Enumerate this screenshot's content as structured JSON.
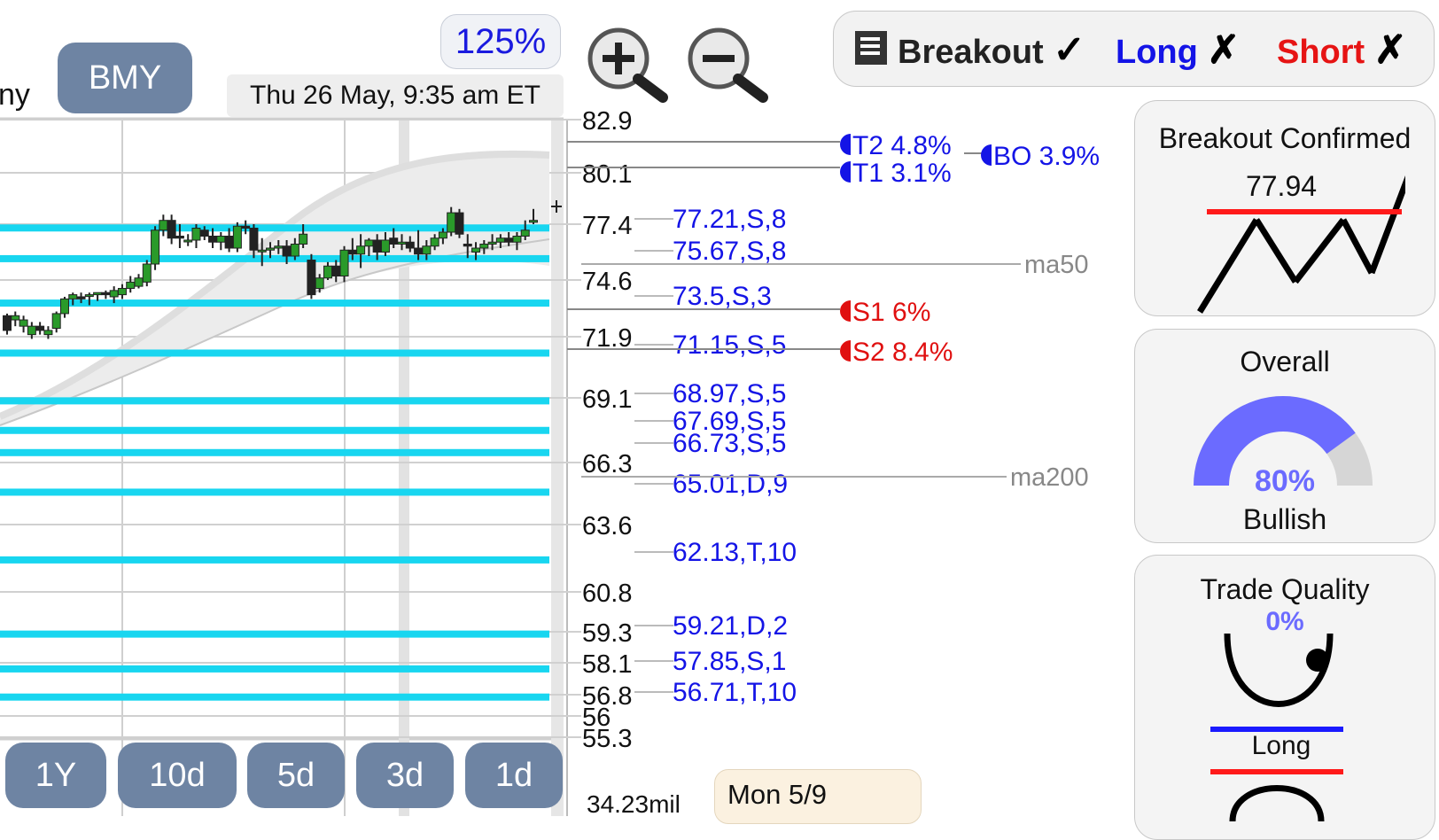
{
  "toolbar": {
    "partial_title": "ny",
    "ticker": "BMY",
    "zoom": "125%",
    "datetime": "Thu 26 May, 9:35 am ET",
    "zoom_in_icon": "magnifier-plus-icon",
    "zoom_out_icon": "magnifier-minus-icon"
  },
  "filters": {
    "menu_icon": "list-icon",
    "breakout": {
      "label": "Breakout",
      "mark": "✓",
      "color": "#222222"
    },
    "long": {
      "label": "Long",
      "mark": "✗",
      "color": "#1414e6"
    },
    "short": {
      "label": "Short",
      "mark": "✗",
      "color": "#e61414"
    }
  },
  "timeframes": [
    "1Y",
    "10d",
    "5d",
    "3d",
    "1d"
  ],
  "hover_date": "Mon 5/9",
  "chart_data": {
    "type": "candlestick",
    "y_axis": {
      "min": 55.3,
      "max": 82.9,
      "ticks": [
        "82.9",
        "80.1",
        "77.4",
        "74.6",
        "71.9",
        "69.1",
        "66.3",
        "63.6",
        "60.8",
        "59.3",
        "58.1",
        "56.8",
        "56",
        "55.3"
      ]
    },
    "volume_label": "34.23mil",
    "candles": [
      [
        72.9,
        73.0,
        72.0,
        72.2
      ],
      [
        72.7,
        73.1,
        72.4,
        72.9
      ],
      [
        72.4,
        72.9,
        72.1,
        72.7
      ],
      [
        72.0,
        72.6,
        71.8,
        72.4
      ],
      [
        72.4,
        72.6,
        72.0,
        72.2
      ],
      [
        72.0,
        72.4,
        71.8,
        72.2
      ],
      [
        72.3,
        73.1,
        72.1,
        73.0
      ],
      [
        73.0,
        73.8,
        72.8,
        73.7
      ],
      [
        73.7,
        74.0,
        73.4,
        73.9
      ],
      [
        73.8,
        74.0,
        73.5,
        73.7
      ],
      [
        73.9,
        74.0,
        73.4,
        73.9
      ],
      [
        73.9,
        74.0,
        73.6,
        74.0
      ],
      [
        74.0,
        74.1,
        73.7,
        73.9
      ],
      [
        73.8,
        74.3,
        73.5,
        74.1
      ],
      [
        73.9,
        74.4,
        73.7,
        74.2
      ],
      [
        74.2,
        74.8,
        74.0,
        74.5
      ],
      [
        74.3,
        74.9,
        74.2,
        74.7
      ],
      [
        74.5,
        75.6,
        74.3,
        75.4
      ],
      [
        75.4,
        77.3,
        75.1,
        77.1
      ],
      [
        77.1,
        77.9,
        76.8,
        77.6
      ],
      [
        77.6,
        77.9,
        76.4,
        76.7
      ],
      [
        76.8,
        77.4,
        76.2,
        76.7
      ],
      [
        76.6,
        76.9,
        76.3,
        76.6
      ],
      [
        76.6,
        77.4,
        76.2,
        77.2
      ],
      [
        77.1,
        77.3,
        76.6,
        76.8
      ],
      [
        76.8,
        77.2,
        76.2,
        76.5
      ],
      [
        76.5,
        77.0,
        76.1,
        76.8
      ],
      [
        76.8,
        77.2,
        76.0,
        76.2
      ],
      [
        76.2,
        77.5,
        76.0,
        77.3
      ],
      [
        77.3,
        77.6,
        76.9,
        77.2
      ],
      [
        77.2,
        77.4,
        75.7,
        76.1
      ],
      [
        76.1,
        76.7,
        75.3,
        76.1
      ],
      [
        76.1,
        76.5,
        75.7,
        76.2
      ],
      [
        76.2,
        76.6,
        75.9,
        76.3
      ],
      [
        76.3,
        76.6,
        75.4,
        75.8
      ],
      [
        75.8,
        76.7,
        75.6,
        76.4
      ],
      [
        76.4,
        77.4,
        76.2,
        76.9
      ],
      [
        75.6,
        75.9,
        73.7,
        73.9
      ],
      [
        74.2,
        74.9,
        74.0,
        74.7
      ],
      [
        74.7,
        75.5,
        74.6,
        75.3
      ],
      [
        75.3,
        75.6,
        74.5,
        74.8
      ],
      [
        74.8,
        76.3,
        74.5,
        76.1
      ],
      [
        76.1,
        76.7,
        75.6,
        75.9
      ],
      [
        75.9,
        76.9,
        75.2,
        76.3
      ],
      [
        76.3,
        76.7,
        75.8,
        76.6
      ],
      [
        76.6,
        76.9,
        75.6,
        76.0
      ],
      [
        76.0,
        77.0,
        75.8,
        76.6
      ],
      [
        76.7,
        77.2,
        76.2,
        76.4
      ],
      [
        76.4,
        76.9,
        76.1,
        76.5
      ],
      [
        76.5,
        76.8,
        76.0,
        76.2
      ],
      [
        76.2,
        77.1,
        75.6,
        75.9
      ],
      [
        75.9,
        76.6,
        75.6,
        76.3
      ],
      [
        76.3,
        76.9,
        76.1,
        76.7
      ],
      [
        76.7,
        77.2,
        76.4,
        77.0
      ],
      [
        77.0,
        78.3,
        76.8,
        78.0
      ],
      [
        78.0,
        78.2,
        76.7,
        76.9
      ],
      [
        76.4,
        76.9,
        75.7,
        76.3
      ],
      [
        76.0,
        76.5,
        75.6,
        76.2
      ],
      [
        76.2,
        76.6,
        75.9,
        76.4
      ],
      [
        76.4,
        76.9,
        76.1,
        76.5
      ],
      [
        76.5,
        76.9,
        76.2,
        76.7
      ],
      [
        76.7,
        77.0,
        76.3,
        76.5
      ],
      [
        76.5,
        77.0,
        76.1,
        76.8
      ],
      [
        76.8,
        77.6,
        76.6,
        77.1
      ],
      [
        77.5,
        78.2,
        77.4,
        77.6
      ]
    ],
    "support_levels": [
      77.21,
      75.67,
      73.5,
      71.15,
      68.97,
      67.69,
      66.73,
      65.01,
      62.13,
      59.21,
      57.85,
      56.71
    ],
    "level_labels": [
      "77.21,S,8",
      "75.67,S,8",
      "73.5,S,3",
      "71.15,S,5",
      "68.97,S,5",
      "67.69,S,5",
      "66.73,S,5",
      "65.01,D,9",
      "62.13,T,10",
      "59.21,D,2",
      "57.85,S,1",
      "56.71,T,10"
    ],
    "moving_averages": [
      {
        "name": "ma50",
        "value": 75.6
      },
      {
        "name": "ma200",
        "value": 65.3
      }
    ],
    "targets": [
      {
        "label": "T2 4.8%",
        "value": 81.7
      },
      {
        "label": "T1 3.1%",
        "value": 80.3
      }
    ],
    "breakout": {
      "label": "BO 3.9%",
      "value": 81.0
    },
    "stops": [
      {
        "label": "S1 6%",
        "value": 73.3
      },
      {
        "label": "S2 8.4%",
        "value": 71.4
      }
    ],
    "colors": {
      "up": "#2a9a2a",
      "down": "#222222",
      "support": "#18d6f0",
      "target": "#1414e6",
      "stop": "#e01010"
    }
  },
  "panels": {
    "breakout": {
      "title": "Breakout Confirmed",
      "price": "77.94"
    },
    "overall": {
      "title": "Overall",
      "value": "80%",
      "fraction": 0.8,
      "label": "Bullish",
      "color": "#6b6bff"
    },
    "quality": {
      "title": "Trade Quality",
      "value": "0%",
      "label": "Long"
    }
  }
}
